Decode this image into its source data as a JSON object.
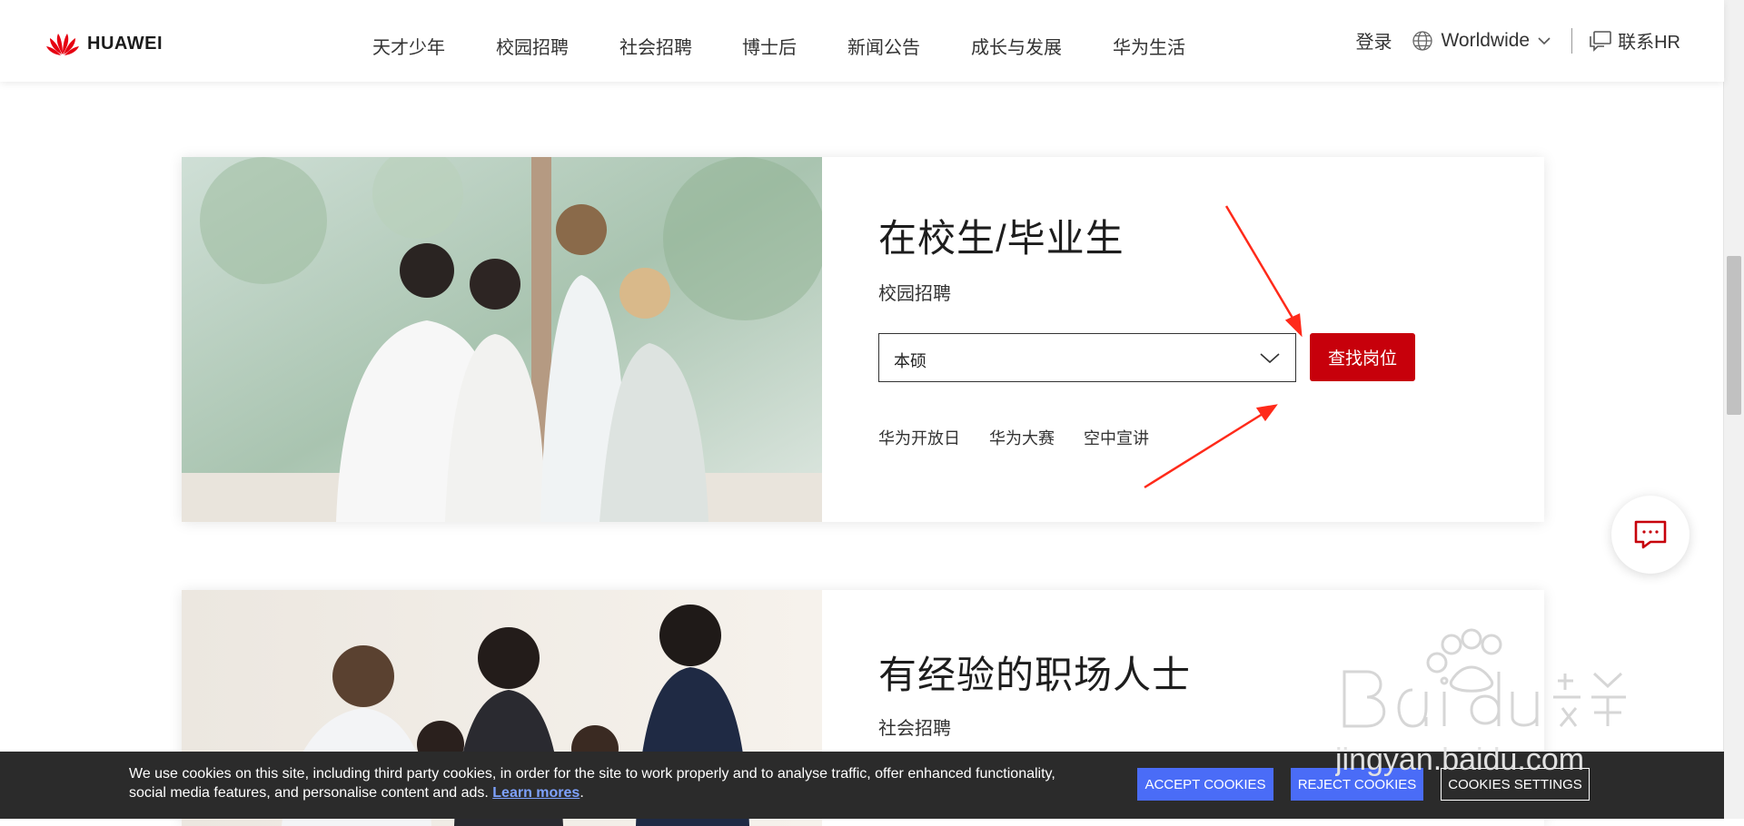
{
  "header": {
    "brand": "HUAWEI",
    "nav": [
      "天才少年",
      "校园招聘",
      "社会招聘",
      "博士后",
      "新闻公告",
      "成长与发展",
      "华为生活"
    ],
    "login": "登录",
    "region": "Worldwide",
    "contact": "联系HR"
  },
  "cards": [
    {
      "title": "在校生/毕业生",
      "subtitle": "校园招聘",
      "select_value": "本硕",
      "search_button": "查找岗位",
      "links": [
        "华为开放日",
        "华为大赛",
        "空中宣讲"
      ]
    },
    {
      "title": "有经验的职场人士",
      "subtitle": "社会招聘"
    }
  ],
  "cookie_bar": {
    "text": "We use cookies on this site, including third party cookies, in order for the site to work properly and to analyse traffic, offer enhanced functionality, social media features, and personalise content and ads.",
    "learn_more": "Learn mores",
    "accept": "ACCEPT COOKIES",
    "reject": "REJECT COOKIES",
    "settings": "COOKIES SETTINGS"
  },
  "colors": {
    "brand_red": "#c7000b",
    "cookie_bg": "#2b2b2b",
    "cookie_button": "#4a6cf7",
    "annotation_arrow": "#ff2a1a"
  },
  "icons": {
    "logo": "huawei-petal-logo",
    "region": "globe-icon",
    "region_toggle": "chevron-down-icon",
    "contact": "chat-window-icon",
    "select_toggle": "chevron-down-icon",
    "chat_fab": "message-bubble-icon"
  }
}
